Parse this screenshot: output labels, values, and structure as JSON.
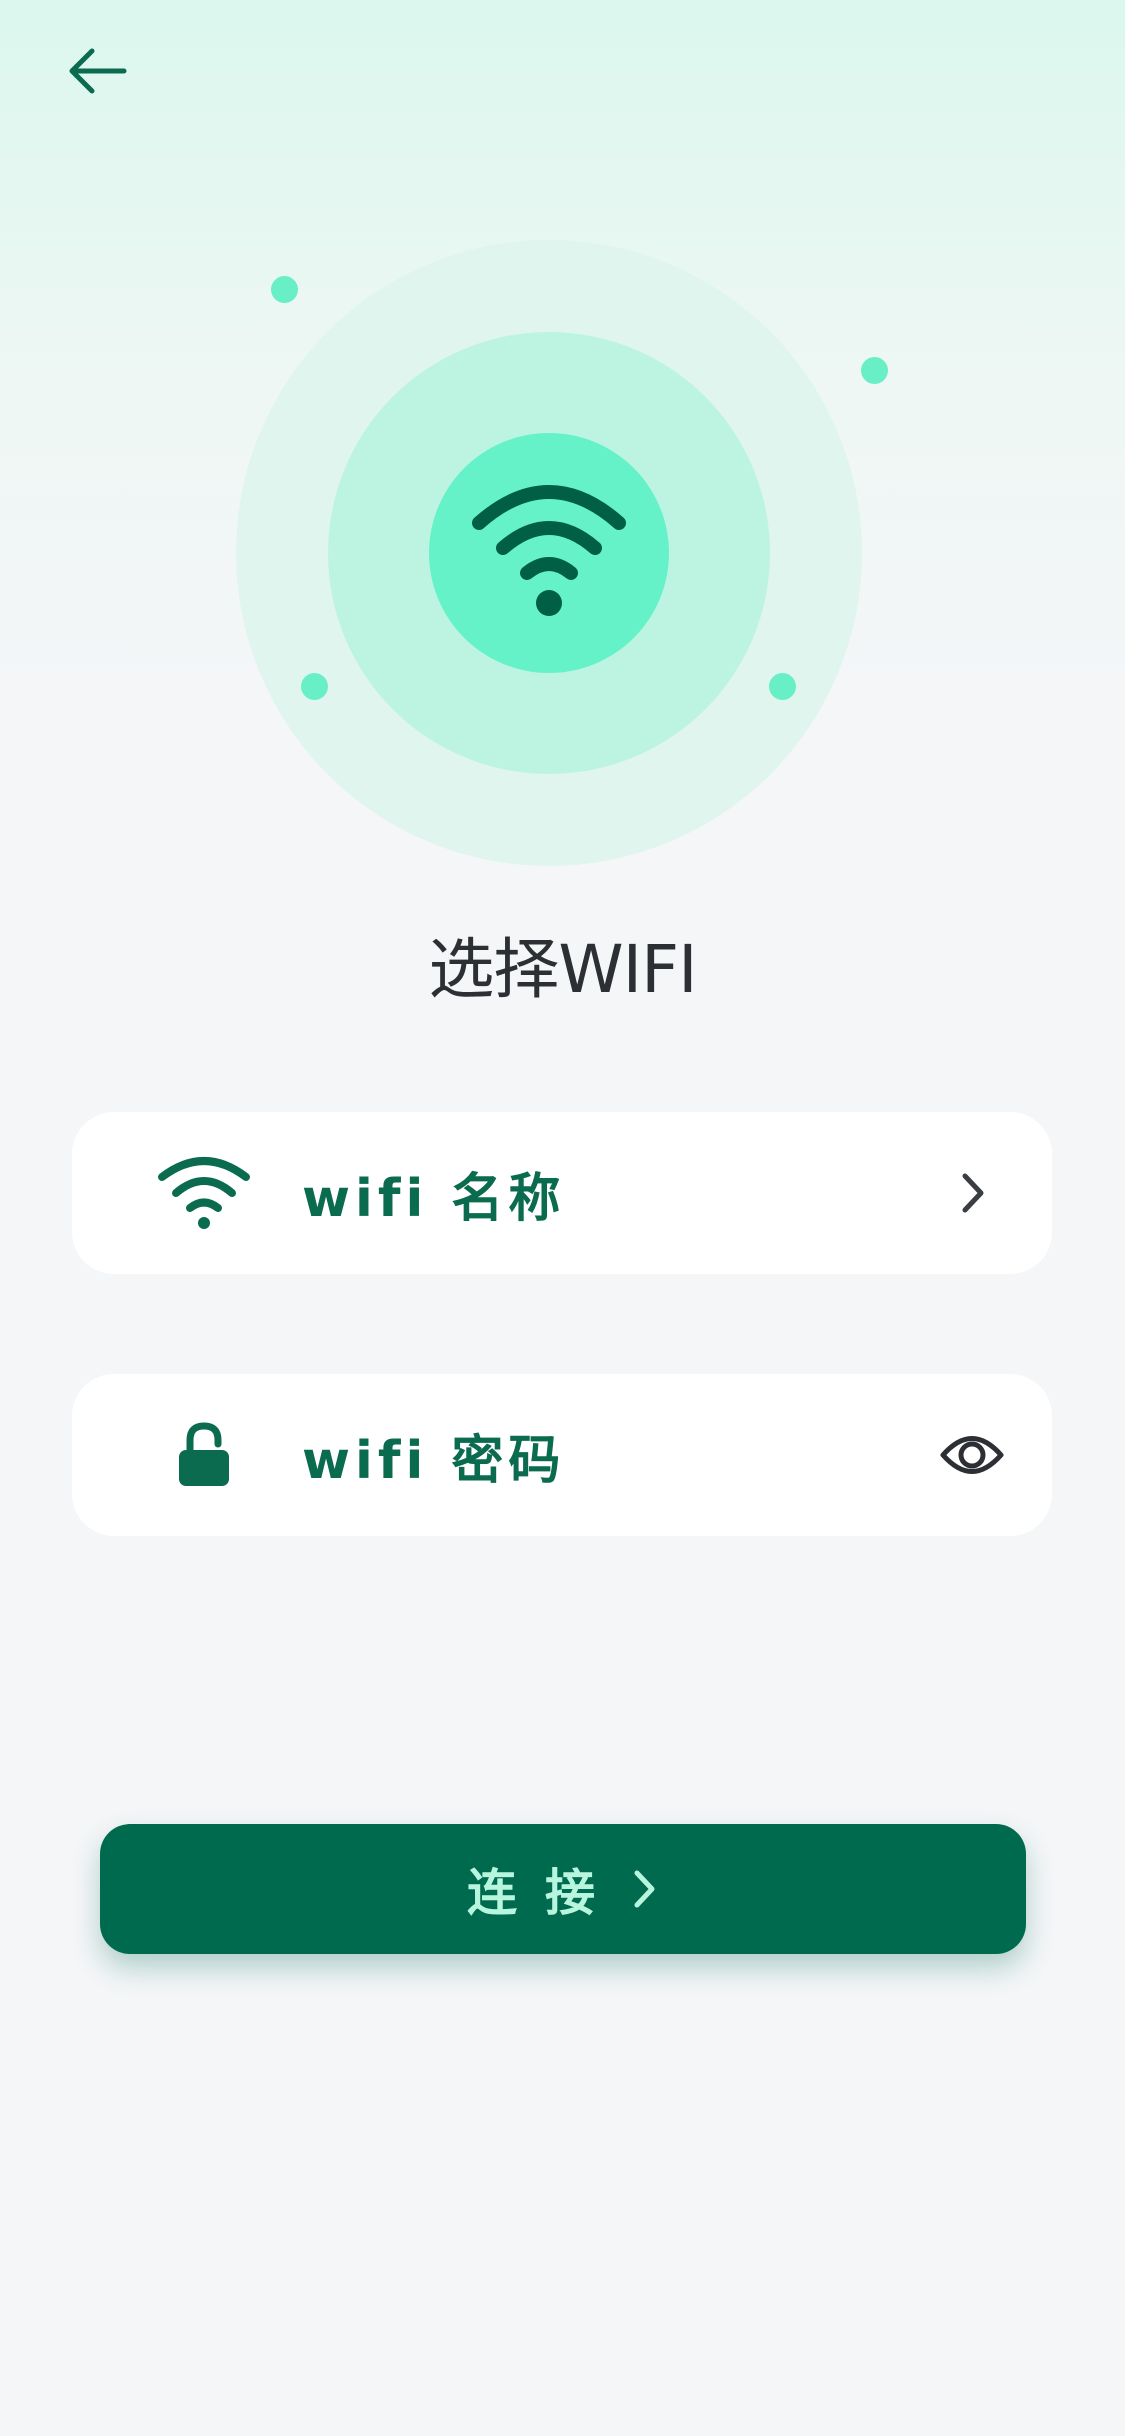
{
  "header": {
    "back_icon": "arrow-left-icon"
  },
  "hero": {
    "icon": "wifi-icon",
    "colors": {
      "outer_ring": "#dff5ee",
      "middle_ring": "#bdf4e1",
      "inner_circle": "#66f2c8",
      "dots": "#69efc5",
      "glyph": "#005f45"
    }
  },
  "title": "选择WIFI",
  "fields": {
    "ssid": {
      "label": "wifi 名称",
      "icon_left": "wifi-icon",
      "icon_right": "chevron-right-icon"
    },
    "password": {
      "label": "wifi 密码",
      "icon_left": "lock-icon",
      "icon_right": "eye-icon"
    }
  },
  "connect_button": {
    "label": "连接",
    "icon": "chevron-right-icon"
  },
  "theme": {
    "primary": "#006a4e",
    "accent": "#66f2c8",
    "text_dark": "#2c2f33",
    "field_text": "#0b6b4e",
    "button_text": "#b8f5de"
  }
}
